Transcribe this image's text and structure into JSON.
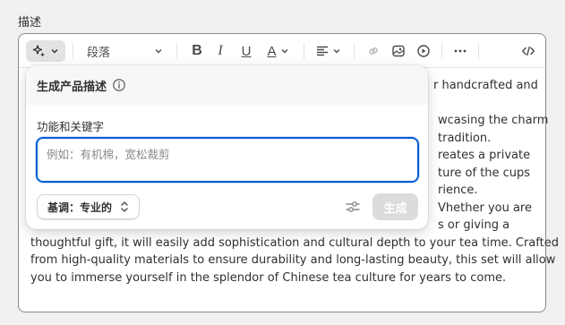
{
  "field_label": "描述",
  "toolbar": {
    "paragraph_label": "段落",
    "bold": "B",
    "italic": "I",
    "underline": "U",
    "text_color": "A"
  },
  "content_lines": [
    "r handcrafted and",
    "wcasing the charm",
    "tradition.",
    "reates a private",
    "ture of the cups",
    "rience.",
    "Vhether you are",
    "s or giving a",
    "thoughtful gift, it will easily add sophistication and cultural depth to your tea time. Crafted",
    "from high-quality materials to ensure durability and long-lasting beauty, this set will allow",
    "you to immerse yourself in the splendor of Chinese tea culture for years to come."
  ],
  "popover": {
    "title": "生成产品描述",
    "keywords_label": "功能和关键字",
    "keywords_placeholder": "例如：有机棉，宽松裁剪",
    "tone_label": "基调：专业的",
    "generate_label": "生成"
  },
  "colors": {
    "focus_border": "#005bd3",
    "generate_disabled": "#dcdcdc"
  }
}
